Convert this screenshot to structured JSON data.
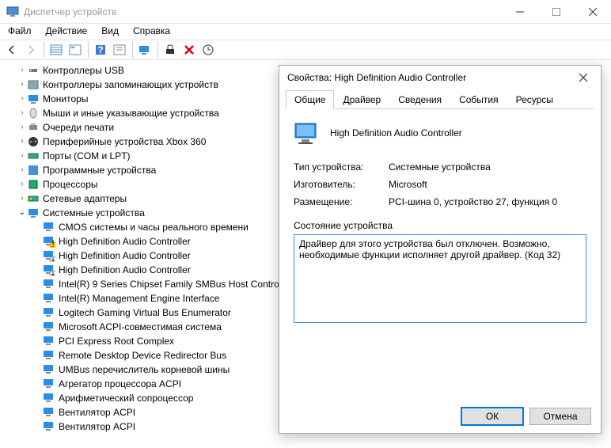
{
  "window": {
    "title": "Диспетчер устройств"
  },
  "menu": {
    "file": "Файл",
    "action": "Действие",
    "view": "Вид",
    "help": "Справка"
  },
  "tree": {
    "items": [
      {
        "label": "Контроллеры USB"
      },
      {
        "label": "Контроллеры запоминающих устройств"
      },
      {
        "label": "Мониторы"
      },
      {
        "label": "Мыши и иные указывающие устройства"
      },
      {
        "label": "Очереди печати"
      },
      {
        "label": "Периферийные устройства Xbox 360"
      },
      {
        "label": "Порты (COM и LPT)"
      },
      {
        "label": "Программные устройства"
      },
      {
        "label": "Процессоры"
      },
      {
        "label": "Сетевые адаптеры"
      },
      {
        "label": "Системные устройства"
      }
    ],
    "sys_children": [
      "CMOS системы и часы реального времени",
      "High Definition Audio Controller",
      "High Definition Audio Controller",
      "High Definition Audio Controller",
      "Intel(R) 9 Series Chipset Family SMBus Host Contro",
      "Intel(R) Management Engine Interface",
      "Logitech Gaming Virtual Bus Enumerator",
      "Microsoft ACPI-совместимая система",
      "PCI Express Root Complex",
      "Remote Desktop Device Redirector Bus",
      "UMBus перечислитель корневой шины",
      "Агрегатор процессора ACPI",
      "Арифметический сопроцессор",
      "Вентилятор ACPI",
      "Вентилятор ACPI"
    ]
  },
  "dialog": {
    "title": "Свойства: High Definition Audio Controller",
    "tabs": {
      "general": "Общие",
      "driver": "Драйвер",
      "details": "Сведения",
      "events": "События",
      "resources": "Ресурсы"
    },
    "device_name": "High Definition Audio Controller",
    "rows": {
      "type_k": "Тип устройства:",
      "type_v": "Системные устройства",
      "mfg_k": "Изготовитель:",
      "mfg_v": "Microsoft",
      "loc_k": "Размещение:",
      "loc_v": "PCI-шина 0, устройство 27, функция 0"
    },
    "status_label": "Состояние устройства",
    "status_text": "Драйвер для этого устройства был отключен. Возможно, необходимые функции исполняет другой драйвер. (Код 32)",
    "ok": "ОК",
    "cancel": "Отмена"
  }
}
